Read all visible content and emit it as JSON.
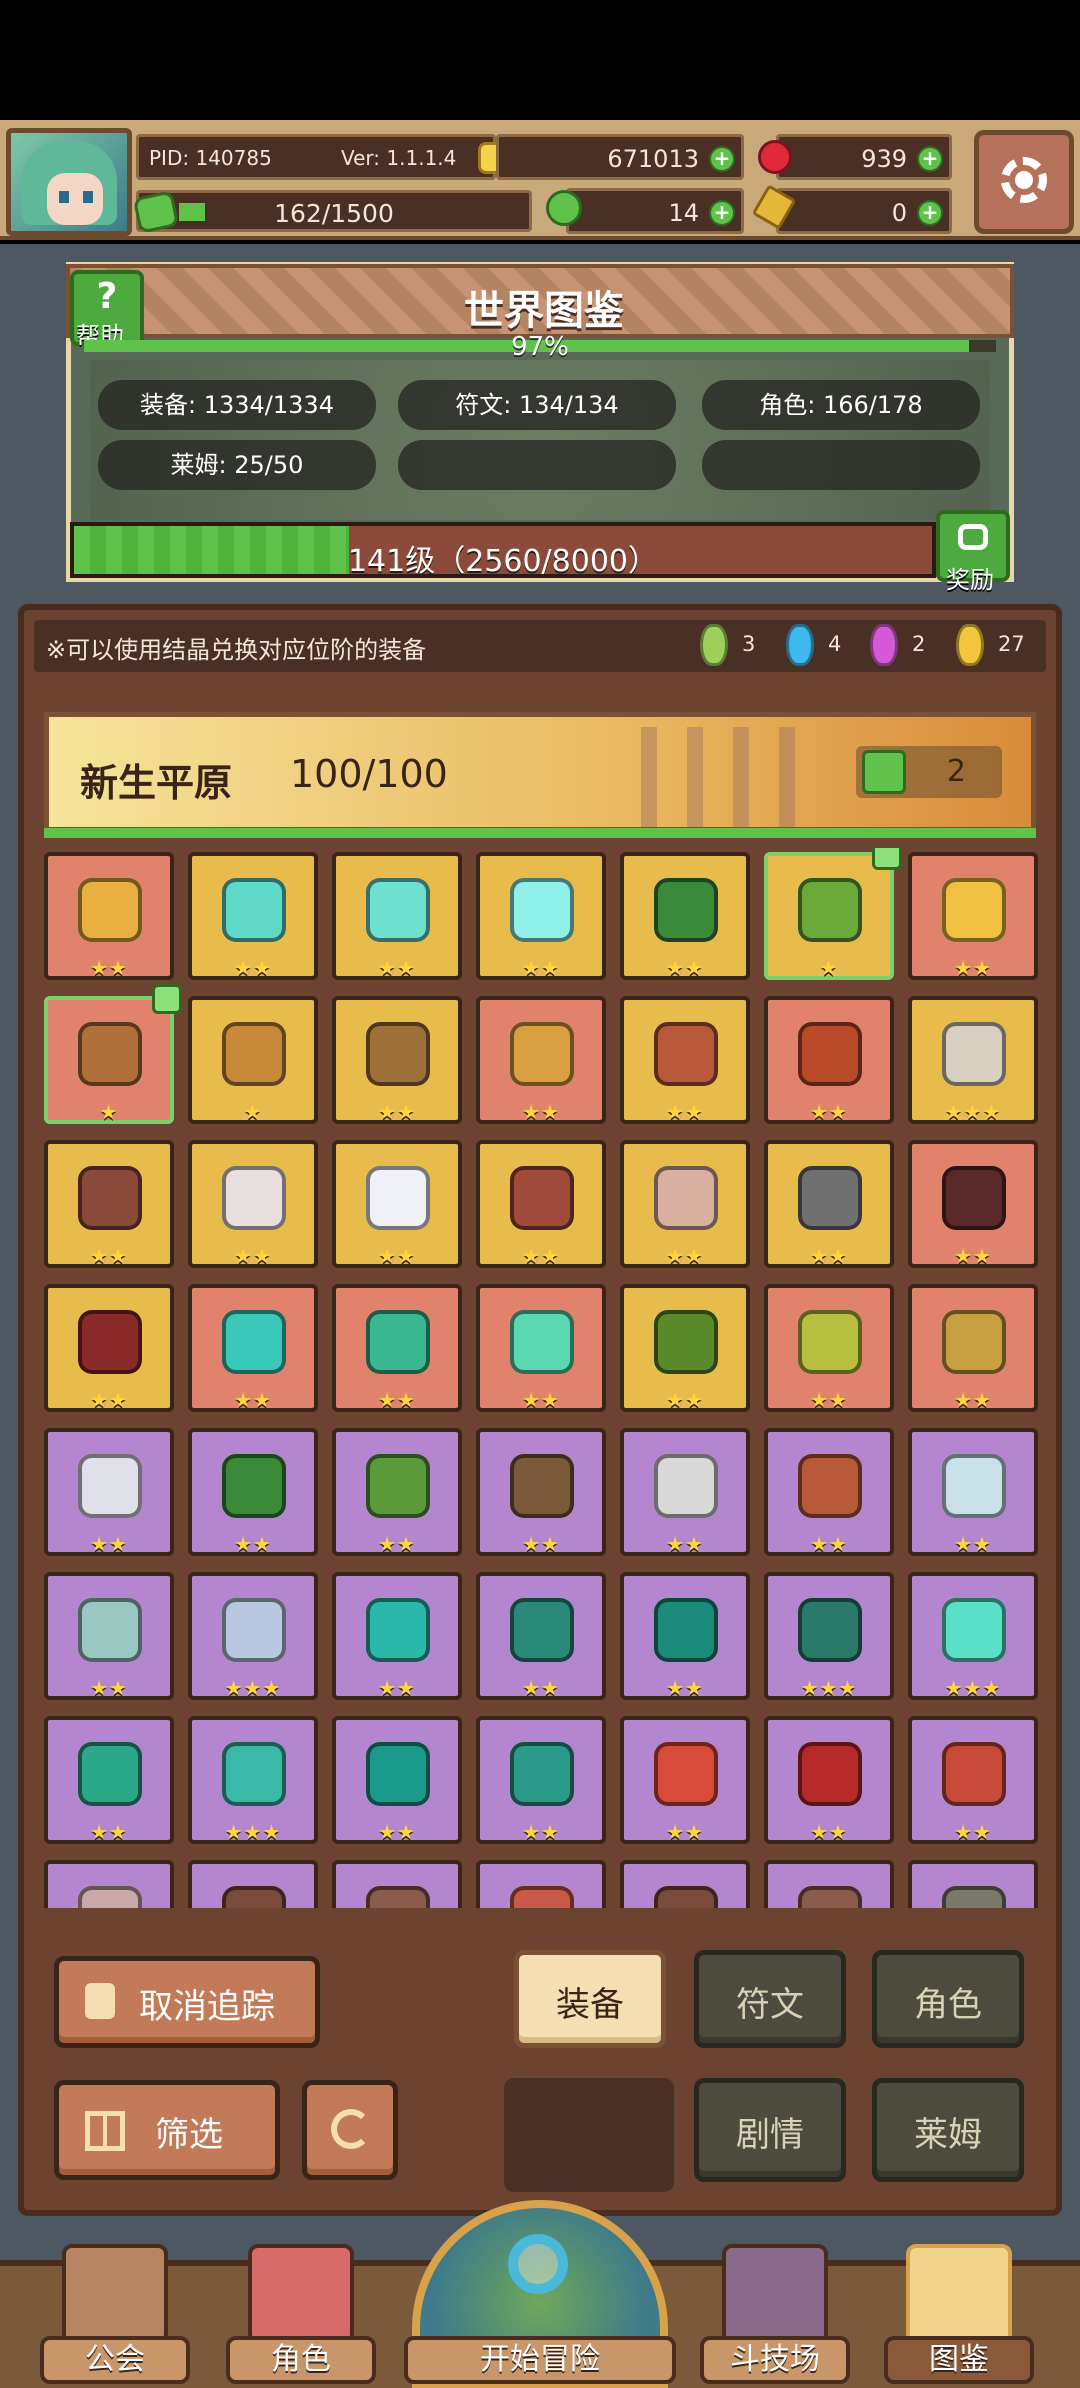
{
  "header": {
    "pid": "PID: 140785",
    "version": "Ver: 1.1.1.4",
    "gold": "671013",
    "rubies": "939",
    "stamina": "162/1500",
    "clovers": "14",
    "keys": "0",
    "plus": "+"
  },
  "atlas": {
    "title": "世界图鉴",
    "help_label": "帮助",
    "help_glyph": "?",
    "percent_text": "97%",
    "percent": 0.97,
    "stats": [
      "装备: 1334/1334",
      "符文: 134/134",
      "角色: 166/178",
      "莱姆: 25/50"
    ],
    "level_text": "141级（2560/8000）",
    "level_progress": 0.32,
    "reward_label": "奖励"
  },
  "collection": {
    "hint": "※可以使用结晶兑换对应位阶的装备",
    "crystals": [
      {
        "color": "#9dcf5a",
        "count": "3"
      },
      {
        "color": "#3fb8f0",
        "count": "4"
      },
      {
        "color": "#d65ad8",
        "count": "2"
      },
      {
        "color": "#f2c63a",
        "count": "27"
      }
    ],
    "region_title": "新生平原",
    "region_count": "100/100",
    "likes": "2",
    "tiles": [
      {
        "bg": "red",
        "stars": "★★",
        "icon": "#e8b040",
        "tracked": false
      },
      {
        "bg": "yellow",
        "stars": "★★",
        "icon": "#5fd8c8",
        "tracked": false
      },
      {
        "bg": "yellow",
        "stars": "★★",
        "icon": "#6ee0d0",
        "tracked": false
      },
      {
        "bg": "yellow",
        "stars": "★★",
        "icon": "#8ef0e8",
        "tracked": false
      },
      {
        "bg": "yellow",
        "stars": "★★",
        "icon": "#3a8a3a",
        "tracked": false
      },
      {
        "bg": "yellow",
        "stars": "★",
        "icon": "#6aaa3a",
        "tracked": true
      },
      {
        "bg": "red",
        "stars": "★★",
        "icon": "#f0c040",
        "tracked": false
      },
      {
        "bg": "red",
        "stars": "★",
        "icon": "#b0703a",
        "tracked": true
      },
      {
        "bg": "yellow",
        "stars": "★",
        "icon": "#c88a3a",
        "tracked": false
      },
      {
        "bg": "yellow",
        "stars": "★★",
        "icon": "#a0703a",
        "tracked": false
      },
      {
        "bg": "red",
        "stars": "★★",
        "icon": "#d8a040",
        "tracked": false
      },
      {
        "bg": "yellow",
        "stars": "★★",
        "icon": "#b85a3a",
        "tracked": false
      },
      {
        "bg": "red",
        "stars": "★★",
        "icon": "#b84a2a",
        "tracked": false
      },
      {
        "bg": "yellow",
        "stars": "★★★",
        "icon": "#d8d0c0",
        "tracked": false
      },
      {
        "bg": "yellow",
        "stars": "★★",
        "icon": "#8a4a3a",
        "tracked": false
      },
      {
        "bg": "yellow",
        "stars": "★★",
        "icon": "#e8e0e0",
        "tracked": false
      },
      {
        "bg": "yellow",
        "stars": "★★",
        "icon": "#f0f0f8",
        "tracked": false
      },
      {
        "bg": "yellow",
        "stars": "★★",
        "icon": "#a04a3a",
        "tracked": false
      },
      {
        "bg": "yellow",
        "stars": "★★",
        "icon": "#d8b0a0",
        "tracked": false
      },
      {
        "bg": "yellow",
        "stars": "★★",
        "icon": "#707070",
        "tracked": false
      },
      {
        "bg": "red",
        "stars": "★★",
        "icon": "#5a2a2a",
        "tracked": false
      },
      {
        "bg": "yellow",
        "stars": "★★",
        "icon": "#8a2a2a",
        "tracked": false
      },
      {
        "bg": "red",
        "stars": "★★",
        "icon": "#3ac8b8",
        "tracked": false
      },
      {
        "bg": "red",
        "stars": "★★",
        "icon": "#3ab890",
        "tracked": false
      },
      {
        "bg": "red",
        "stars": "★★",
        "icon": "#5ad8b0",
        "tracked": false
      },
      {
        "bg": "yellow",
        "stars": "★★",
        "icon": "#5a8a2a",
        "tracked": false
      },
      {
        "bg": "red",
        "stars": "★★",
        "icon": "#b8c040",
        "tracked": false
      },
      {
        "bg": "red",
        "stars": "★★",
        "icon": "#c8a040",
        "tracked": false
      },
      {
        "bg": "purple",
        "stars": "★★",
        "icon": "#e0e0e8",
        "tracked": false
      },
      {
        "bg": "purple",
        "stars": "★★",
        "icon": "#3a8a3a",
        "tracked": false
      },
      {
        "bg": "purple",
        "stars": "★★",
        "icon": "#5a9a3a",
        "tracked": false
      },
      {
        "bg": "purple",
        "stars": "★★",
        "icon": "#7a5a3a",
        "tracked": false
      },
      {
        "bg": "purple",
        "stars": "★★",
        "icon": "#d8d8d8",
        "tracked": false
      },
      {
        "bg": "purple",
        "stars": "★★",
        "icon": "#b85a3a",
        "tracked": false
      },
      {
        "bg": "purple",
        "stars": "★★",
        "icon": "#c8e0e8",
        "tracked": false
      },
      {
        "bg": "purple",
        "stars": "★★",
        "icon": "#9ac8c0",
        "tracked": false
      },
      {
        "bg": "purple",
        "stars": "★★★",
        "icon": "#b8c8e0",
        "tracked": false
      },
      {
        "bg": "purple",
        "stars": "★★",
        "icon": "#2ab8a8",
        "tracked": false
      },
      {
        "bg": "purple",
        "stars": "★★",
        "icon": "#2a8a7a",
        "tracked": false
      },
      {
        "bg": "purple",
        "stars": "★★",
        "icon": "#1a8a7a",
        "tracked": false
      },
      {
        "bg": "purple",
        "stars": "★★★",
        "icon": "#2a7a6a",
        "tracked": false
      },
      {
        "bg": "purple",
        "stars": "★★★",
        "icon": "#5ae0c8",
        "tracked": false
      },
      {
        "bg": "purple",
        "stars": "★★",
        "icon": "#2aa88a",
        "tracked": false
      },
      {
        "bg": "purple",
        "stars": "★★★",
        "icon": "#3ab8a8",
        "tracked": false
      },
      {
        "bg": "purple",
        "stars": "★★",
        "icon": "#1a9a8a",
        "tracked": false
      },
      {
        "bg": "purple",
        "stars": "★★",
        "icon": "#2a9a8a",
        "tracked": false
      },
      {
        "bg": "purple",
        "stars": "★★",
        "icon": "#d84a3a",
        "tracked": false
      },
      {
        "bg": "purple",
        "stars": "★★",
        "icon": "#b82a2a",
        "tracked": false
      },
      {
        "bg": "purple",
        "stars": "★★",
        "icon": "#c84a3a",
        "tracked": false
      },
      {
        "bg": "purple",
        "stars": "",
        "icon": "#c8a8a8",
        "tracked": false
      },
      {
        "bg": "purple",
        "stars": "",
        "icon": "#7a4a3a",
        "tracked": false
      },
      {
        "bg": "purple",
        "stars": "",
        "icon": "#8a5a4a",
        "tracked": false
      },
      {
        "bg": "purple",
        "stars": "",
        "icon": "#c85a4a",
        "tracked": false
      },
      {
        "bg": "purple",
        "stars": "",
        "icon": "#7a4a3a",
        "tracked": false
      },
      {
        "bg": "purple",
        "stars": "",
        "icon": "#8a5a4a",
        "tracked": false
      },
      {
        "bg": "purple",
        "stars": "",
        "icon": "#7a7a6a",
        "tracked": false
      }
    ]
  },
  "controls": {
    "untrack": "取消追踪",
    "filter": "筛选",
    "tabs": [
      "装备",
      "符文",
      "角色",
      "剧情",
      "莱姆"
    ]
  },
  "nav": {
    "guild": "公会",
    "character": "角色",
    "adventure": "开始冒险",
    "arena": "斗技场",
    "atlas": "图鉴"
  }
}
